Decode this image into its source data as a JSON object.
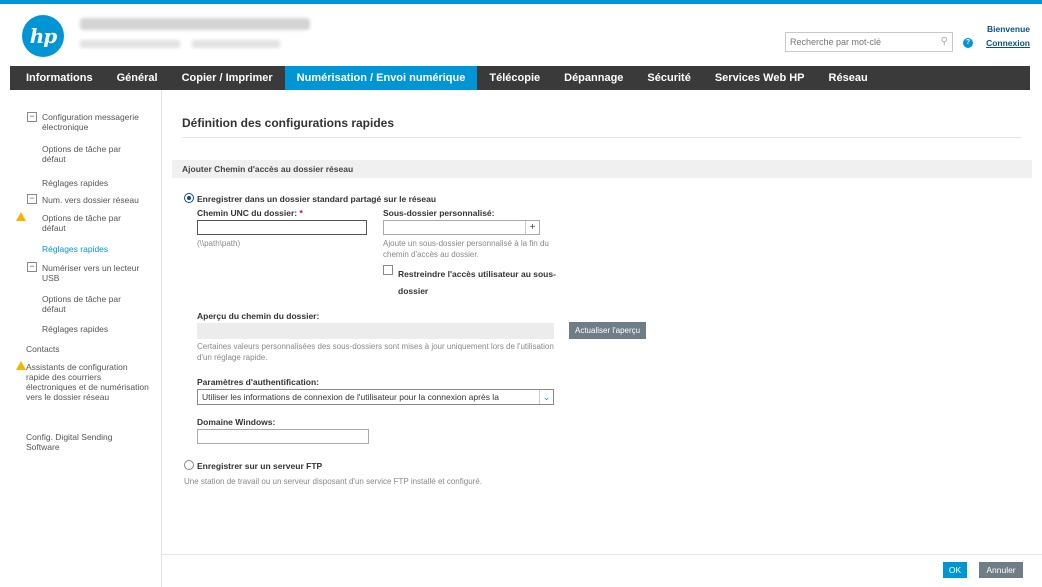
{
  "header": {
    "search_placeholder": "Recherche par mot-clé",
    "welcome": "Bienvenue",
    "signin": "Connexion",
    "logo_text": "hp"
  },
  "nav": {
    "items": [
      "Informations",
      "Général",
      "Copier / Imprimer",
      "Numérisation / Envoi numérique",
      "Télécopie",
      "Dépannage",
      "Sécurité",
      "Services Web HP",
      "Réseau"
    ],
    "active_index": 3
  },
  "sidebar": {
    "email_setup": "Configuration messagerie électronique",
    "email_default_options": "Options de tâche par défaut",
    "email_quick_sets": "Réglages rapides",
    "folder": "Num. vers dossier réseau",
    "folder_default_options": "Options de tâche par défaut",
    "folder_quick_sets": "Réglages rapides",
    "usb": "Numériser vers un lecteur USB",
    "usb_default_options": "Options de tâche par défaut",
    "usb_quick_sets": "Réglages rapides",
    "contacts": "Contacts",
    "wizards": "Assistants de configuration rapide des courriers électroniques et de numérisation vers le dossier réseau",
    "digital_sending": "Config. Digital Sending Software"
  },
  "main": {
    "title": "Définition des configurations rapides",
    "section": "Ajouter Chemin d'accès au dossier réseau",
    "option_network": "Enregistrer dans un dossier standard partagé sur le réseau",
    "unc_label": "Chemin UNC du dossier:",
    "unc_required": "*",
    "unc_hint": "(\\\\path\\path)",
    "subfolder_label": "Sous-dossier personnalisé:",
    "subfolder_help": "Ajoute un sous-dossier personnalisé à la fin du chemin d'accès au dossier.",
    "restrict_label": "Restreindre l'accès utilisateur au sous-dossier",
    "preview_label": "Aperçu du chemin du dossier:",
    "refresh_button": "Actualiser l'aperçu",
    "preview_help": "Certaines valeurs personnalisées des sous-dossiers sont mises à jour uniquement lors de l'utilisation d'un réglage rapide.",
    "auth_label": "Paramètres d'authentification:",
    "auth_value": "Utiliser les informations de connexion de l'utilisateur pour la connexion après la",
    "domain_label": "Domaine Windows:",
    "option_ftp": "Enregistrer sur un serveur FTP",
    "ftp_help": "Une station de travail ou un serveur disposant d'un service FTP installé et configuré."
  },
  "footer": {
    "ok": "OK",
    "cancel": "Annuler"
  },
  "colors": {
    "accent": "#0096d6",
    "nav_bg": "#3a3a3a",
    "warning": "#f5b400"
  }
}
